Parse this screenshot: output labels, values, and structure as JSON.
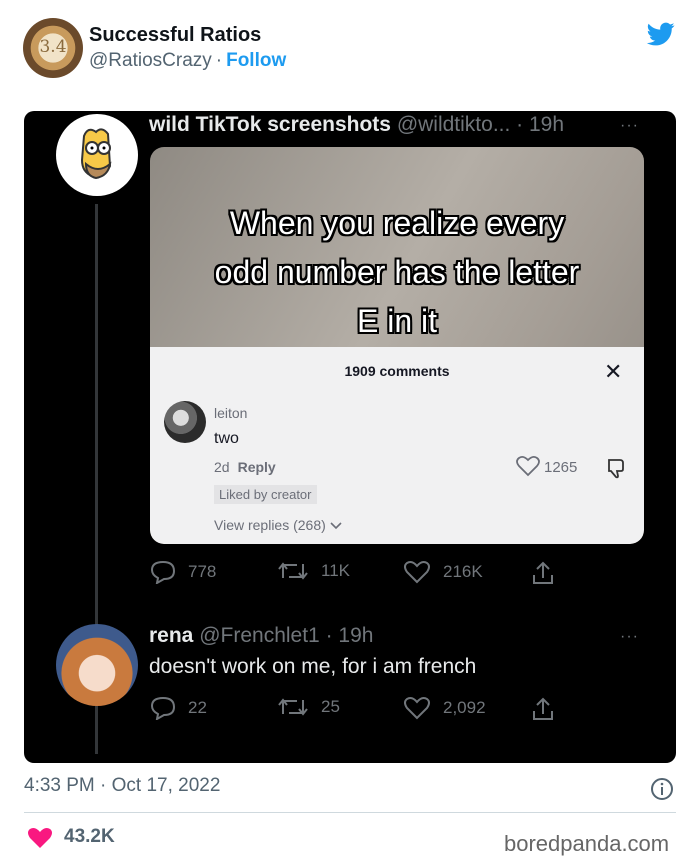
{
  "header": {
    "avatar_text": "3.4",
    "name": "Successful Ratios",
    "handle": "@RatiosCrazy",
    "separator": "·",
    "follow_label": "Follow"
  },
  "embedded": {
    "tweet1": {
      "name": "wild TikTok screenshots",
      "handle": "@wildtikto...",
      "age": "19h",
      "more": "···",
      "media": {
        "caption_lines": [
          "When you realize every",
          "odd number has the letter",
          "E in it"
        ],
        "panel": {
          "count": "1909 comments",
          "close": "✕",
          "user": "leiton",
          "text": "two",
          "age": "2d",
          "reply": "Reply",
          "liked": "Liked by creator",
          "views": "View replies (268)",
          "likes": "1265"
        }
      },
      "actions": {
        "replies": "778",
        "retweets": "11K",
        "likes": "216K"
      }
    },
    "tweet2": {
      "name": "rena",
      "handle": "@Frenchlet1",
      "age": "19h",
      "more": "···",
      "text": "doesn't work on me, for i am french",
      "actions": {
        "replies": "22",
        "retweets": "25",
        "likes": "2,092"
      }
    }
  },
  "footer": {
    "timestamp": "4:33 PM · Oct 17, 2022",
    "likes": "43.2K",
    "watermark": "boredpanda.com"
  },
  "colors": {
    "accent": "#1d9bf0",
    "like_red": "#f91880",
    "dark_bg": "#000000"
  }
}
